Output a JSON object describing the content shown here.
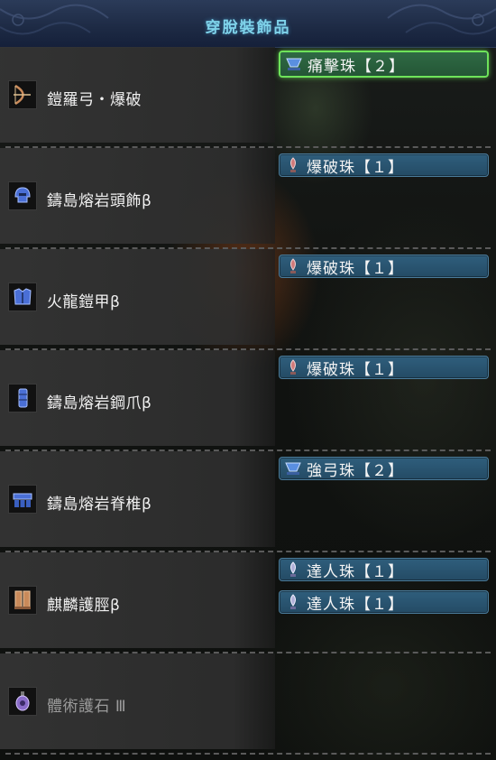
{
  "header": {
    "title": "穿脫裝飾品"
  },
  "equipment": [
    {
      "name": "鎧羅弓・爆破",
      "icon": "bow-icon",
      "icon_color": "#c98a5a",
      "decorations": [
        {
          "label": "痛擊珠【２】",
          "icon": "decoration-level2-icon",
          "selected": true
        }
      ]
    },
    {
      "name": "鑄島熔岩頭飾β",
      "icon": "head-armor-icon",
      "icon_color": "#4a6fd6",
      "decorations": [
        {
          "label": "爆破珠【１】",
          "icon": "decoration-level1-icon",
          "selected": false
        }
      ]
    },
    {
      "name": "火龍鎧甲β",
      "icon": "chest-armor-icon",
      "icon_color": "#4a6fd6",
      "decorations": [
        {
          "label": "爆破珠【１】",
          "icon": "decoration-level1-icon",
          "selected": false
        }
      ]
    },
    {
      "name": "鑄島熔岩鋼爪β",
      "icon": "arm-armor-icon",
      "icon_color": "#4a6fd6",
      "decorations": [
        {
          "label": "爆破珠【１】",
          "icon": "decoration-level1-icon",
          "selected": false
        }
      ]
    },
    {
      "name": "鑄島熔岩脊椎β",
      "icon": "waist-armor-icon",
      "icon_color": "#4a6fd6",
      "decorations": [
        {
          "label": "強弓珠【２】",
          "icon": "decoration-level2-icon",
          "selected": false
        }
      ]
    },
    {
      "name": "麒麟護脛β",
      "icon": "leg-armor-icon",
      "icon_color": "#c98a5a",
      "decorations": [
        {
          "label": "達人珠【１】",
          "icon": "decoration-level1-icon",
          "selected": false
        },
        {
          "label": "達人珠【１】",
          "icon": "decoration-level1-icon",
          "selected": false
        }
      ]
    },
    {
      "name": "體術護石 Ⅲ",
      "icon": "charm-icon",
      "icon_color": "#8a6cc9",
      "decorations": []
    }
  ],
  "colors": {
    "title": "#7fd3ea",
    "slot_bg": "#2a5572",
    "slot_active_border": "#6ee35a"
  }
}
